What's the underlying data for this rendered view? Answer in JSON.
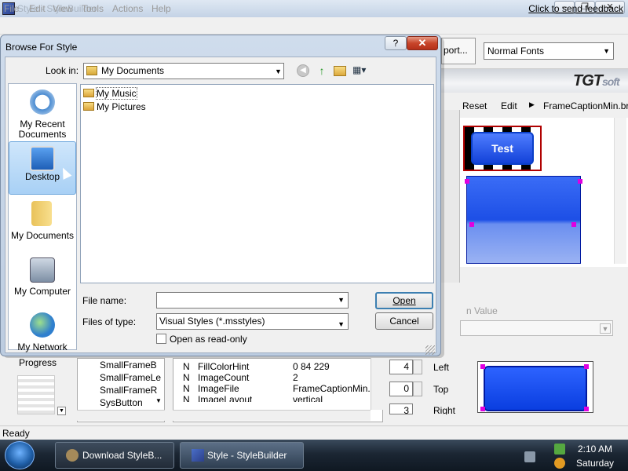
{
  "app": {
    "title": "Style - StyleBuilder",
    "menu": [
      "File",
      "Edit",
      "View",
      "Tools",
      "Actions",
      "Help"
    ],
    "feedback_link": "Click to send feedback",
    "toolbar_partial_button": "port...",
    "fonts_select": "Normal Fonts",
    "brand": "TGT",
    "brand_suffix": "soft",
    "props_toolbar": {
      "reset": "Reset",
      "edit": "Edit",
      "frame_name": "FrameCaptionMin.br"
    },
    "preview_test_label": "Test",
    "value_label": "n Value",
    "palette_label": "Progress",
    "tree_items": [
      "SmallFrameB",
      "SmallFrameLe",
      "SmallFrameR",
      "SysButton"
    ],
    "grid_rows": [
      {
        "type": "N",
        "name": "FillColorHint",
        "value": "0 84 229"
      },
      {
        "type": "N",
        "name": "ImageCount",
        "value": "2"
      },
      {
        "type": "N",
        "name": "ImageFile",
        "value": "FrameCaptionMin..."
      },
      {
        "type": "N",
        "name": "ImageLayout",
        "value": "vertical"
      }
    ],
    "margins": [
      {
        "label": "Left",
        "value": "4"
      },
      {
        "label": "Top",
        "value": "0"
      },
      {
        "label": "Right",
        "value": "3"
      }
    ],
    "status": "Ready"
  },
  "dialog": {
    "title": "Browse For Style",
    "help_label": "?",
    "close_label": "✕",
    "look_in_label": "Look in:",
    "look_in_value": "My Documents",
    "places": [
      {
        "label": "My Recent Documents",
        "icon": "clock-icon"
      },
      {
        "label": "Desktop",
        "icon": "desktop-icon"
      },
      {
        "label": "My Documents",
        "icon": "folder-icon"
      },
      {
        "label": "My Computer",
        "icon": "computer-icon"
      },
      {
        "label": "My Network",
        "icon": "network-icon"
      }
    ],
    "files": [
      "My Music",
      "My Pictures"
    ],
    "file_name_label": "File name:",
    "file_name_value": "",
    "files_of_type_label": "Files of type:",
    "files_of_type_value": "Visual Styles (*.msstyles)",
    "open_readonly_label": "Open as read-only",
    "open_button": "Open",
    "cancel_button": "Cancel"
  },
  "taskbar": {
    "buttons": [
      "Download StyleB...",
      "Style - StyleBuilder"
    ],
    "time": "2:10 AM",
    "day": "Saturday"
  },
  "colors": {
    "accent_blue": "#1241d8",
    "close_red": "#c8452a",
    "taskbar": "#1b2633"
  }
}
